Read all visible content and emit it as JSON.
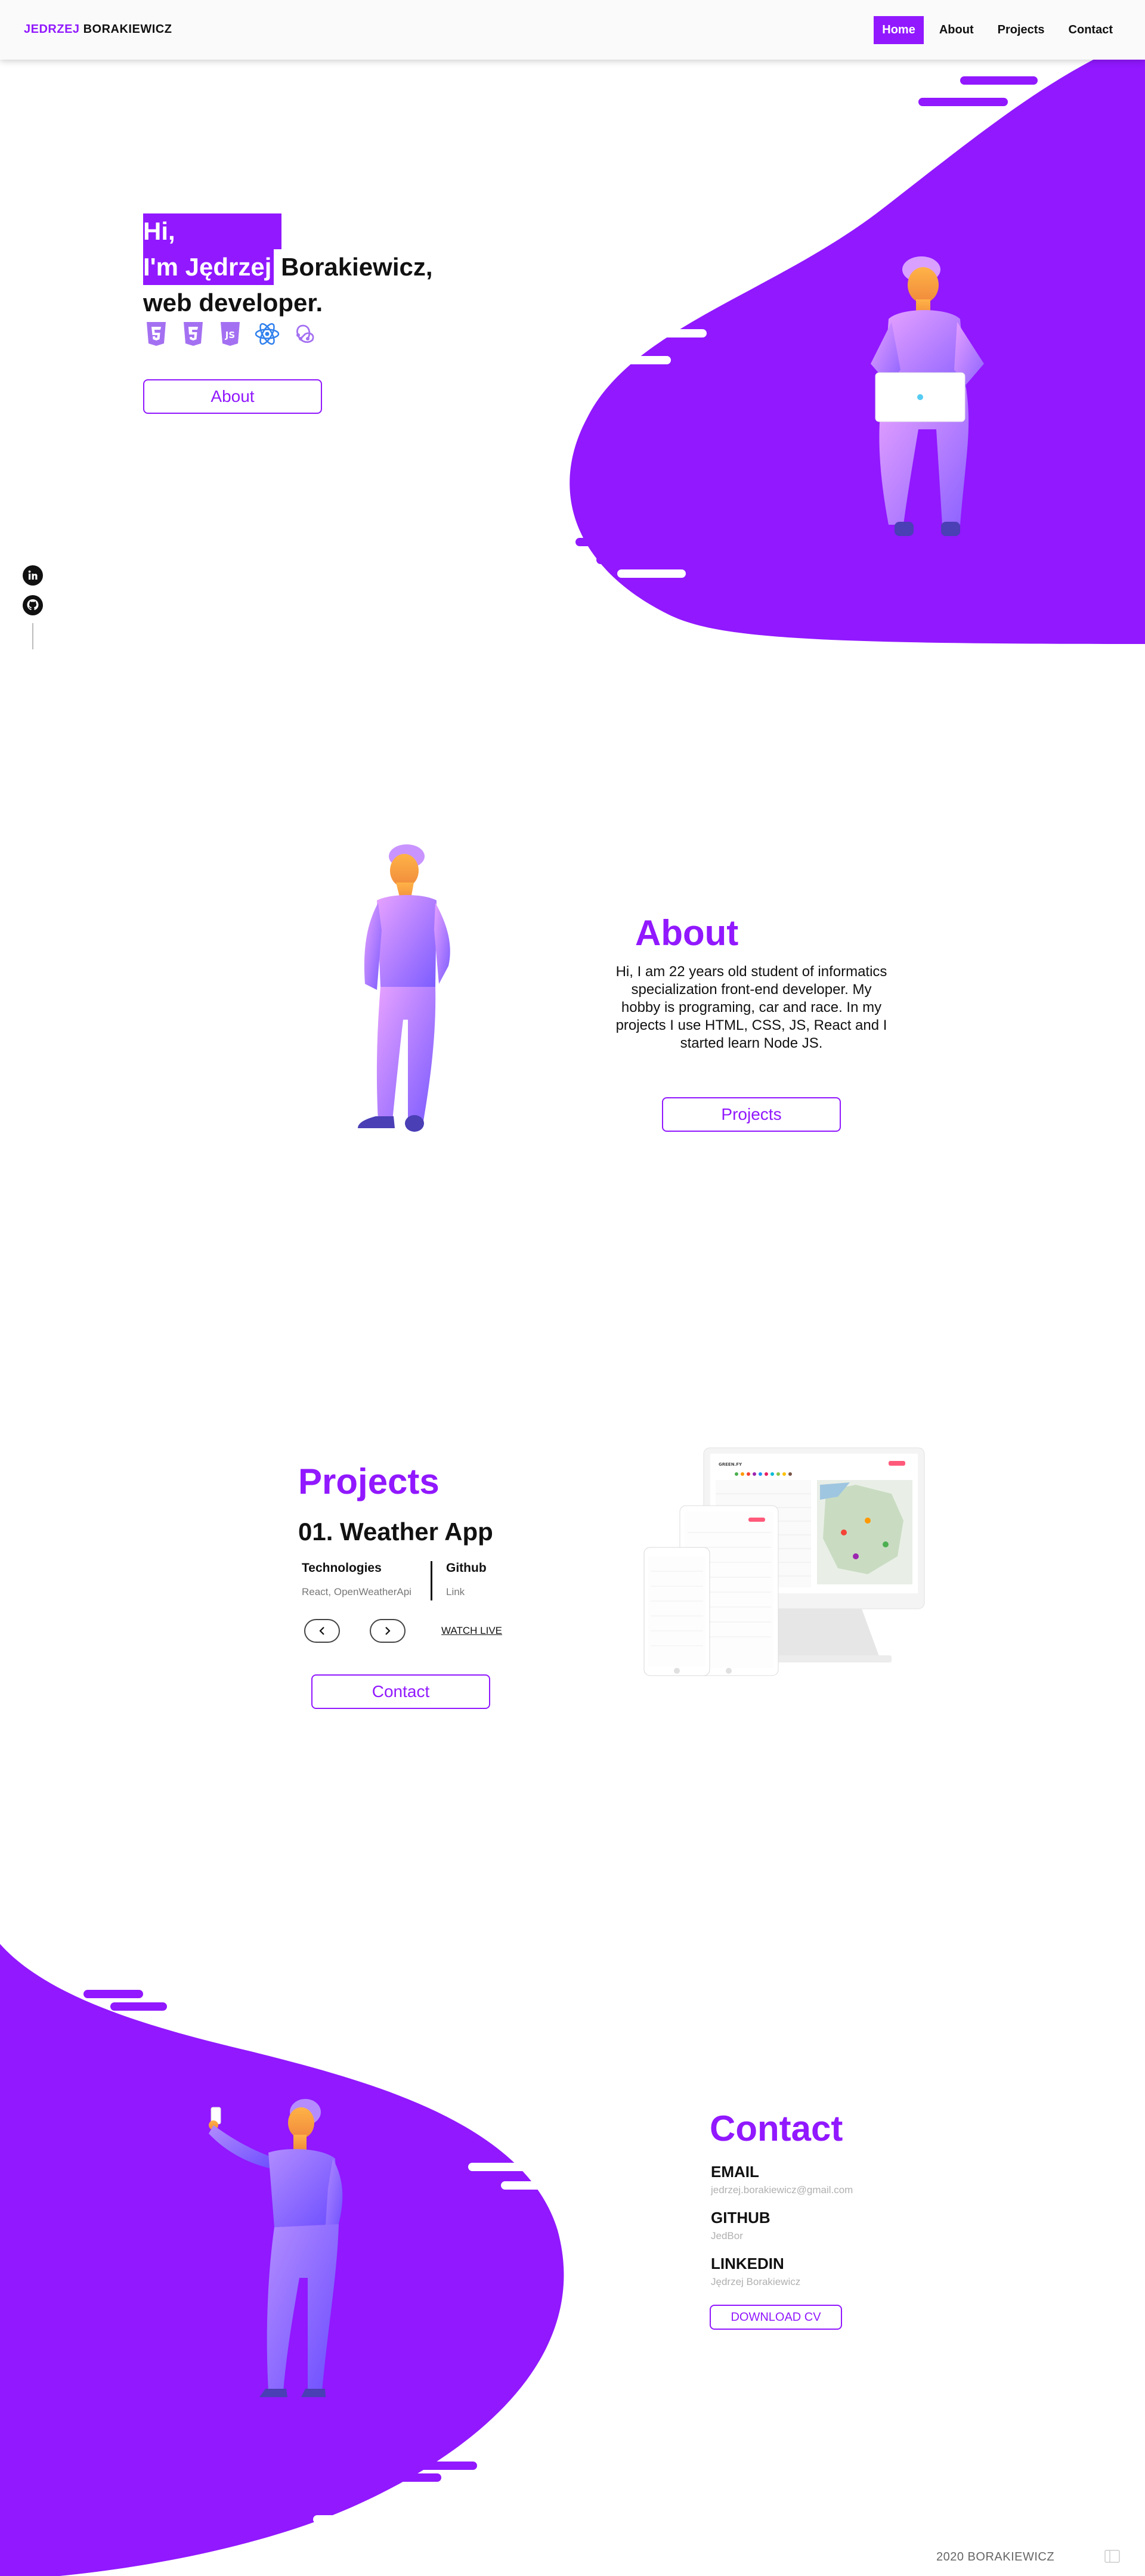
{
  "brand": {
    "first": "JEDRZEJ",
    "last": "BORAKIEWICZ",
    "accent": "#9118ff"
  },
  "nav": {
    "items": [
      {
        "label": "Home"
      },
      {
        "label": "About"
      },
      {
        "label": "Projects"
      },
      {
        "label": "Contact"
      }
    ]
  },
  "hero": {
    "line1": "Hi,",
    "line2_highlight": "I'm Jędrzej",
    "line2_rest": " Borakiewicz,",
    "line3": "web developer.",
    "tech_icons": [
      "html5-icon",
      "css3-icon",
      "js-icon",
      "react-icon",
      "redux-icon"
    ],
    "button": "About"
  },
  "social": {
    "icons": [
      "linkedin-icon",
      "github-icon"
    ]
  },
  "about": {
    "title": "About",
    "text": "Hi, I am 22 years old student of informatics specialization front-end developer. My hobby is programing, car and race. In my projects I use  HTML, CSS, JS, React and I started learn Node JS.",
    "button": "Projects"
  },
  "projects": {
    "title": "Projects",
    "name": "01. Weather App",
    "technologies_label": "Technologies",
    "technologies": "React, OpenWeatherApi",
    "github_label": "Github",
    "github_value": "Link",
    "watch": "WATCH LIVE",
    "button": "Contact",
    "mockup_brand": "GREEN.FY"
  },
  "contact": {
    "title": "Contact",
    "email_label": "EMAIL",
    "email": "jedrzej.borakiewicz@gmail.com",
    "github_label": "GITHUB",
    "github": "JedBor",
    "linkedin_label": "LINKEDIN",
    "linkedin": "Jędrzej Borakiewicz",
    "cv_button": "DOWNLOAD CV"
  },
  "footer": {
    "text": "2020 BORAKIEWICZ"
  }
}
